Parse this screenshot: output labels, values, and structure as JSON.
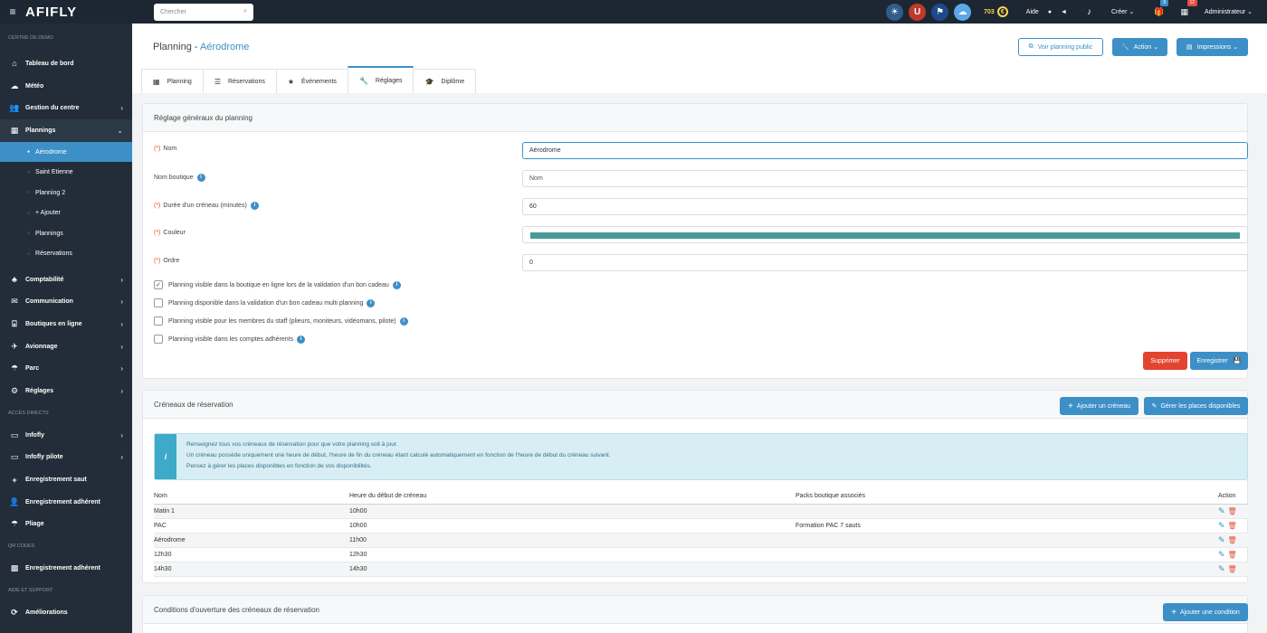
{
  "topbar": {
    "logo": "AFIFLY",
    "search_placeholder": "Chercher",
    "credits": "703",
    "aide": "Aide",
    "creer": "Créer",
    "gift_badge": "9",
    "calendar_badge": "12",
    "user": "Administrateur",
    "colors": {
      "bg": "#1c2733",
      "accent": "#3d8fc7"
    }
  },
  "sidebar": {
    "sec_centre": "CENTRE DE DEMO",
    "items": [
      {
        "label": "Tableau de bord"
      },
      {
        "label": "Météo"
      },
      {
        "label": "Gestion du centre"
      },
      {
        "label": "Plannings"
      }
    ],
    "sub": [
      {
        "label": "Aérodrome"
      },
      {
        "label": "Saint Etienne"
      },
      {
        "label": "Planning 2"
      },
      {
        "label": "+ Ajouter"
      },
      {
        "label": "Plannings"
      },
      {
        "label": "Réservations"
      }
    ],
    "items2": [
      {
        "label": "Comptabilité"
      },
      {
        "label": "Communication"
      },
      {
        "label": "Boutiques en ligne"
      },
      {
        "label": "Avionnage"
      },
      {
        "label": "Parc"
      },
      {
        "label": "Réglages"
      }
    ],
    "sec_acces": "ACCÈS DIRECTS",
    "items3": [
      {
        "label": "Infofly"
      },
      {
        "label": "Infofly pilote"
      },
      {
        "label": "Enregistrement saut"
      },
      {
        "label": "Enregistrement adhérent"
      },
      {
        "label": "Pliage"
      }
    ],
    "sec_qr": "QR CODES",
    "qr_item": "Enregistrement adhérent",
    "sec_aide": "AIDE ET SUPPORT",
    "aide_item": "Améliorations"
  },
  "header": {
    "title_prefix": "Planning - ",
    "title_name": "Aérodrome",
    "btn_public": "Voir planning public",
    "btn_action": "Action",
    "btn_impressions": "Impressions"
  },
  "tabs": [
    {
      "label": "Planning"
    },
    {
      "label": "Réservations"
    },
    {
      "label": "Événements"
    },
    {
      "label": "Réglages"
    },
    {
      "label": "Diplôme"
    }
  ],
  "settings": {
    "title": "Réglage généraux du planning",
    "req": "(*)",
    "nom_label": "Nom",
    "nom_value": "Aérodrome",
    "boutique_label": "Nom boutique",
    "boutique_placeholder": "Nom",
    "duree_label": "Durée d'un créneau (minutes)",
    "duree_value": "60",
    "couleur_label": "Couleur",
    "couleur_value": "#4a9a9a",
    "ordre_label": "Ordre",
    "ordre_value": "0",
    "checks": [
      {
        "label": "Planning visible dans la boutique en ligne lors de la validation d'un bon cadeau",
        "checked": true
      },
      {
        "label": "Planning disponible dans la validation d'un bon cadeau multi planning",
        "checked": false
      },
      {
        "label": "Planning visible pour les membres du staff (plieurs, moniteurs, vidéomans, pilote)",
        "checked": false
      },
      {
        "label": "Planning visible dans les comptes adhérents",
        "checked": false
      }
    ],
    "btn_delete": "Supprimer",
    "btn_save": "Enregistrer"
  },
  "creneaux": {
    "title": "Créneaux de réservation",
    "btn_add": "Ajouter un créneau",
    "btn_places": "Gérer les places disponibles",
    "alert": [
      "Renseignez tous vos créneaux de réservation pour que votre planning soit à jour.",
      "Un créneau possède uniquement une heure de début, l'heure de fin du créneau étant calculé automatiquement en fonction de l'heure de début du créneau suivant.",
      "Pensez à gérer les places disponibles en fonction de vos disponibilités."
    ],
    "columns": [
      "Nom",
      "Heure du début de créneau",
      "Packs boutique associés",
      "Action"
    ],
    "rows": [
      {
        "nom": "Matin 1",
        "heure": "10h00",
        "packs": ""
      },
      {
        "nom": "PAC",
        "heure": "10h00",
        "packs": "Formation PAC 7 sauts"
      },
      {
        "nom": "Aérodrome",
        "heure": "11h00",
        "packs": ""
      },
      {
        "nom": "12h30",
        "heure": "12h30",
        "packs": ""
      },
      {
        "nom": "14h30",
        "heure": "14h30",
        "packs": ""
      }
    ]
  },
  "conditions": {
    "title": "Conditions d'ouverture des créneaux de réservation",
    "btn_add": "Ajouter une condition"
  }
}
